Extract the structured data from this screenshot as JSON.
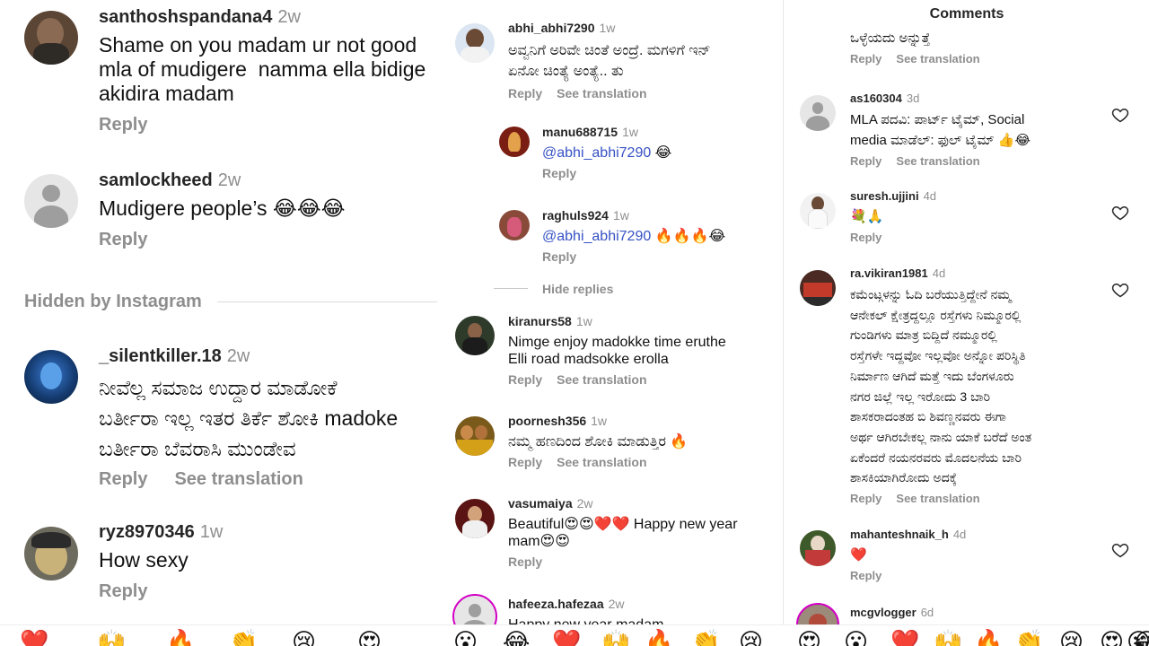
{
  "panel1": {
    "comments": [
      {
        "user": "santhoshspandana4",
        "time": "2w",
        "text": "Shame on you madam ur not good\nmla of mudigere  namma ella bidige\nakidira madam",
        "reply": "Reply"
      },
      {
        "user": "samlockheed",
        "time": "2w",
        "text": "Mudigere people’s 😂😂😂",
        "reply": "Reply"
      },
      {
        "user": "_silentkiller.18",
        "time": "2w",
        "text": "ನೀವೆಲ್ಲ ಸಮಾಜ ಉದ್ದಾರ ಮಾಡೋಕೆ\nಬರ್ತೀರಾ ಇಲ್ಲ ಇತರ ತಿರ್ಕೆ ಶೋಕಿ madoke\nಬರ್ತೀರಾ ಬೆವರಾಸಿ ಮುಂಡೇವ",
        "reply": "Reply",
        "translate": "See translation"
      },
      {
        "user": "ryz8970346",
        "time": "1w",
        "text": "How sexy",
        "reply": "Reply"
      }
    ],
    "hidden_label": "Hidden by Instagram"
  },
  "panel2": {
    "comments": [
      {
        "user": "abhi_abhi7290",
        "time": "1w",
        "text": "ಅವ್ವನಿಗೆ ಅರಿವೇ ಚಿಂತೆ ಅಂದ್ರೆ. ಮಗಳಿಗೆ ಇನ್\nಏನೋ ಚಿಂತ್ಯೆ ಅಂತ್ಯೆ.. ತು",
        "reply": "Reply",
        "translate": "See translation"
      },
      {
        "user": "manu688715",
        "time": "1w",
        "mention": "@abhi_abhi7290",
        "text": " 😂",
        "reply": "Reply"
      },
      {
        "user": "raghuls924",
        "time": "1w",
        "mention": "@abhi_abhi7290",
        "text": " 🔥🔥🔥😂",
        "reply": "Reply"
      },
      {
        "user": "kiranurs58",
        "time": "1w",
        "text": "Nimge enjoy madokke time eruthe\nElli road madsokke erolla",
        "reply": "Reply",
        "translate": "See translation"
      },
      {
        "user": "poornesh356",
        "time": "1w",
        "text": "ನಮ್ಮ ಹಣದಿಂದ ಶೋಕಿ ಮಾಡುತ್ತಿರ 🔥",
        "reply": "Reply",
        "translate": "See translation"
      },
      {
        "user": "vasumaiya",
        "time": "2w",
        "text": "Beautiful😍😍❤️❤️ Happy new year\nmam😍😍",
        "reply": "Reply"
      },
      {
        "user": "hafeeza.hafezaa",
        "time": "2w",
        "text": "Happy new year madam"
      }
    ],
    "hide_replies": "Hide replies"
  },
  "panel3": {
    "title": "Comments",
    "comments": [
      {
        "text": "ಒಳ್ಳೆಯದು ಅನ್ನುತ್ತೆ",
        "reply": "Reply",
        "translate": "See translation"
      },
      {
        "user": "as160304",
        "time": "3d",
        "text": "MLA ಪದವಿ: ಪಾರ್ಟ್ ಟೈಮ್, Social\nmedia ಮಾಡೆಲ್: ಫುಲ್ ಟೈಮ್ 👍😂",
        "reply": "Reply",
        "translate": "See translation"
      },
      {
        "user": "suresh.ujjini",
        "time": "4d",
        "text": "💐🙏",
        "reply": "Reply"
      },
      {
        "user": "ra.vikiran1981",
        "time": "4d",
        "text": "ಕಮೆಂಟ್ಗಳನ್ನು ಓದಿ ಬರೆಯುತ್ತಿದ್ದೇನೆ ನಮ್ಮ\nಆನೇಕಲ್ ಕ್ಷೇತ್ರದ್ದಲ್ಲೂ ರಸ್ತೆಗಳು ನಿಮ್ಮೂರಲ್ಲಿ\nಗುಂಡಿಗಳು ಮಾತ್ರ ಬಿದ್ದಿದೆ ನಮ್ಮೂರಲ್ಲಿ\nರಸ್ತೆಗಳೇ ಇದ್ದವೋ ಇಲ್ಲವೋ ಅನ್ನೋ ಪರಿಸ್ಥಿತಿ\nನಿರ್ಮಾಣ ಆಗಿದೆ ಮತ್ತೆ ಇದು ಬೆಂಗಳೂರು\nನಗರ ಜಿಲ್ಲೆ ಇಲ್ಲ ಇರೋದು 3 ಬಾರಿ\nಶಾಸಕರಾದಂತಹ ಬಿ ಶಿವಣ್ಣನವರು ಈಗಾ\nಅರ್ಥ ಆಗಿರಬೇಕಲ್ಲ ನಾನು ಯಾಕೆ ಬರೆದೆ ಅಂತ\nಏಕೆಂದರೆ ನಯನರವರು ಮೊದಲನೆಯ ಬಾರಿ\nಶಾಸಕಿಯಾಗಿರೋದು ಅದಕ್ಕೆ",
        "reply": "Reply",
        "translate": "See translation"
      },
      {
        "user": "mahanteshnaik_h",
        "time": "4d",
        "text": "❤️",
        "reply": "Reply"
      },
      {
        "user": "mcgvlogger",
        "time": "6d"
      }
    ]
  },
  "emoji_bar": [
    "❤️",
    "🙌",
    "🔥",
    "👏",
    "😢",
    "😍",
    "😮",
    "😂",
    "❤️",
    "🙌",
    "🔥",
    "👏",
    "😢",
    "😍",
    "😮",
    "❤️",
    "🙌",
    "🔥",
    "👏",
    "😢",
    "😍",
    "😮",
    "😂"
  ],
  "colors": {
    "username": "#262626",
    "muted": "#8e8e8e",
    "mention": "#3551c4",
    "heart_outline": "#262626",
    "story_ring": "#d300c5"
  },
  "icons": [
    "heart-outline-icon",
    "default-avatar-icon"
  ]
}
